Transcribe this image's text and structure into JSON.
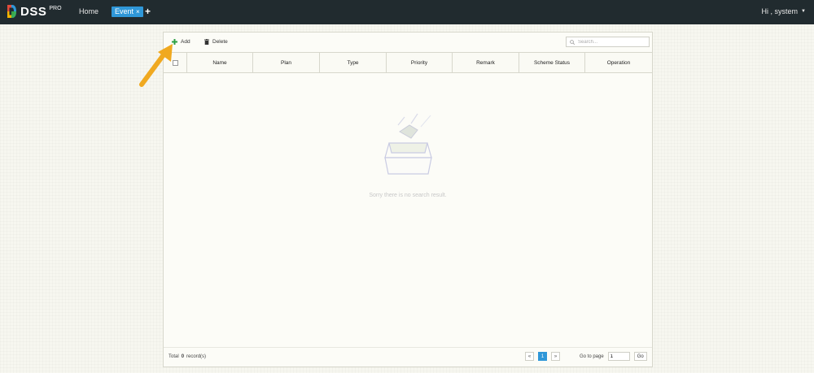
{
  "header": {
    "logo_text": "DSS",
    "logo_sup": "PRO",
    "home": "Home",
    "active_tab": "Event",
    "tab_close": "×",
    "add_tab": "+",
    "greeting": "Hi , system",
    "caret": "▼"
  },
  "toolbar": {
    "add_label": "Add",
    "delete_label": "Delete",
    "search_placeholder": "Search..."
  },
  "table": {
    "columns": [
      "Name",
      "Plan",
      "Type",
      "Priority",
      "Remark",
      "Scheme Status",
      "Operation"
    ],
    "rows": [],
    "empty_message": "Sorry there is no search result."
  },
  "footer": {
    "total_prefix": "Total",
    "total_count": "0",
    "total_suffix": "record(s)",
    "prev": "«",
    "current_page": "1",
    "next": "»",
    "goto_label": "Go to page",
    "goto_value": "1",
    "go_label": "Go"
  },
  "colors": {
    "topbar": "#212b2f",
    "accent": "#2f97d8",
    "add_icon": "#2ea043",
    "callout_arrow": "#f0a920"
  },
  "icons": [
    "dss-logo",
    "plus-icon",
    "trash-icon",
    "search-icon",
    "checkbox",
    "empty-box-illustration",
    "callout-arrow"
  ]
}
